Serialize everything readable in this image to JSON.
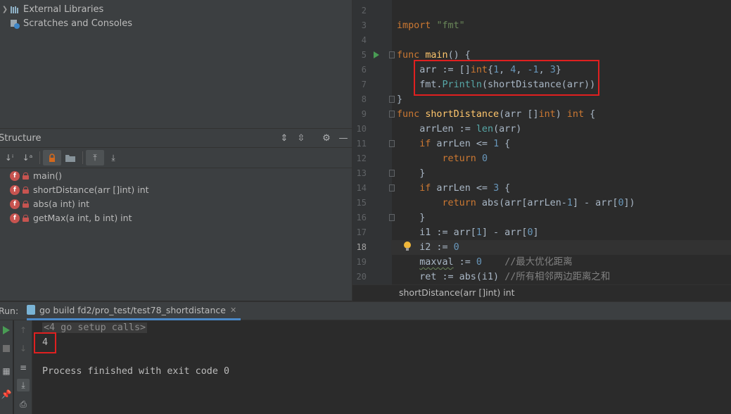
{
  "project": {
    "items": [
      {
        "label": "External Libraries",
        "icon": "library-icon"
      },
      {
        "label": "Scratches and Consoles",
        "icon": "scratches-icon"
      }
    ]
  },
  "structure": {
    "title": "Structure",
    "items": [
      {
        "label": "main()"
      },
      {
        "label": "shortDistance(arr []int) int"
      },
      {
        "label": "abs(a int) int"
      },
      {
        "label": "getMax(a int, b int) int"
      }
    ],
    "badge": "f"
  },
  "editor": {
    "line_numbers": [
      "2",
      "3",
      "4",
      "5",
      "6",
      "7",
      "8",
      "9",
      "10",
      "11",
      "12",
      "13",
      "14",
      "15",
      "16",
      "17",
      "18",
      "19",
      "20"
    ],
    "current_line": "18",
    "breadcrumb": "shortDistance(arr []int) int"
  },
  "run": {
    "label": "Run:",
    "tab_title": "go build fd2/pro_test/test78_shortdistance",
    "console": {
      "setup_calls": "<4 go setup calls>",
      "output": "4",
      "finished": "Process finished with exit code 0"
    }
  },
  "colors": {
    "accent": "#4a88c7",
    "highlight_box": "#e02020",
    "keyword": "#cc7832",
    "string": "#6a8759",
    "number": "#6897bb",
    "function": "#ffc66d"
  }
}
